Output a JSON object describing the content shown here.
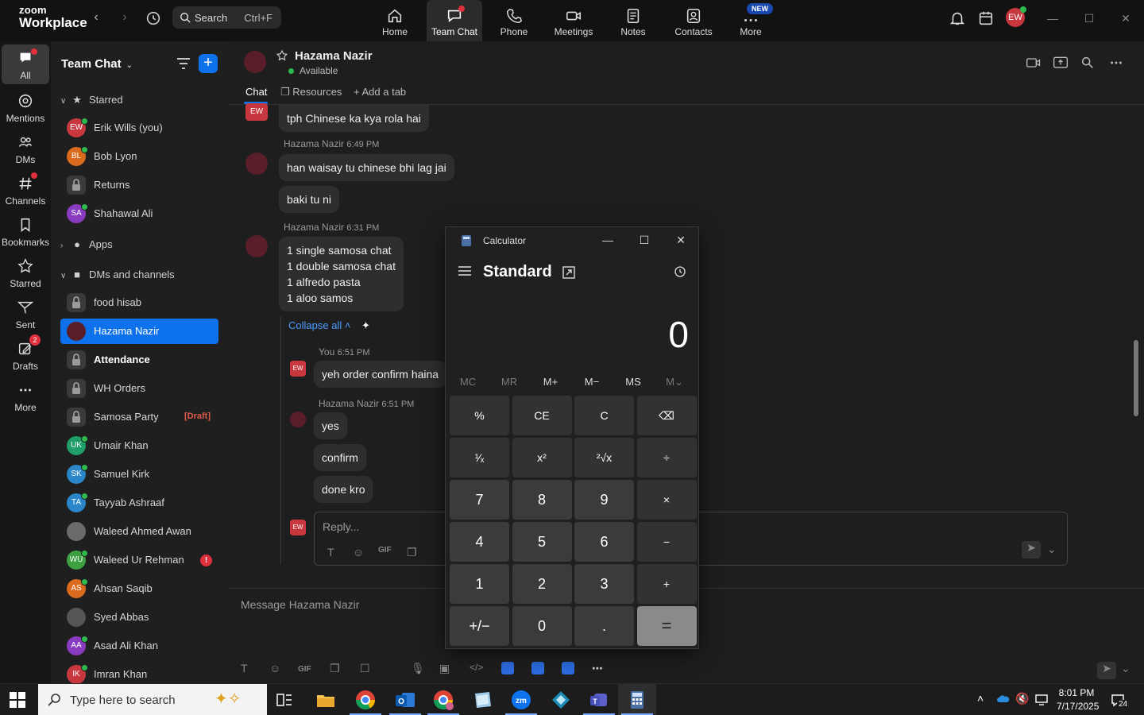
{
  "app": {
    "logo_line1": "zoom",
    "logo_line2": "Workplace",
    "search_label": "Search",
    "search_shortcut": "Ctrl+F",
    "user_initials": "EW",
    "new_badge": "NEW",
    "nav": [
      {
        "label": "Home",
        "icon": "home-icon"
      },
      {
        "label": "Team Chat",
        "icon": "chat-icon"
      },
      {
        "label": "Phone",
        "icon": "phone-icon"
      },
      {
        "label": "Meetings",
        "icon": "video-icon"
      },
      {
        "label": "Notes",
        "icon": "notes-icon"
      },
      {
        "label": "Contacts",
        "icon": "contacts-icon"
      },
      {
        "label": "More",
        "icon": "more-icon"
      }
    ]
  },
  "rail": [
    {
      "label": "All"
    },
    {
      "label": "Mentions"
    },
    {
      "label": "DMs"
    },
    {
      "label": "Channels"
    },
    {
      "label": "Bookmarks"
    },
    {
      "label": "Starred"
    },
    {
      "label": "Sent"
    },
    {
      "label": "Drafts",
      "badge": "2"
    },
    {
      "label": "More"
    }
  ],
  "sidebar": {
    "title": "Team Chat",
    "sections": {
      "starred": "Starred",
      "apps": "Apps",
      "dms": "DMs and channels"
    },
    "starred_items": [
      {
        "name": "Erik Wills (you)",
        "initials": "EW",
        "color": "#c8373e"
      },
      {
        "name": "Bob Lyon",
        "initials": "BL",
        "color": "#d96a1e"
      },
      {
        "name": "Returns",
        "initials": "",
        "color": "#3a3a3a"
      },
      {
        "name": "Shahawal Ali",
        "initials": "SA",
        "color": "#8a3cc0"
      }
    ],
    "dm_items": [
      {
        "name": "food hisab",
        "initials": "",
        "color": "#3a3a3a"
      },
      {
        "name": "Hazama Nazir",
        "initials": "",
        "color": "#5a1e2a"
      },
      {
        "name": "Attendance",
        "initials": "",
        "color": "#3a3a3a"
      },
      {
        "name": "WH Orders",
        "initials": "",
        "color": "#3a3a3a"
      },
      {
        "name": "Samosa Party",
        "initials": "",
        "color": "#3a3a3a",
        "draft": "[Draft]"
      },
      {
        "name": "Umair Khan",
        "initials": "UK",
        "color": "#1f9e6a"
      },
      {
        "name": "Samuel Kirk",
        "initials": "SK",
        "color": "#2a86c8"
      },
      {
        "name": "Tayyab Ashraaf",
        "initials": "TA",
        "color": "#2a86c8"
      },
      {
        "name": "Waleed Ahmed Awan",
        "initials": "",
        "color": "#6b6b6b"
      },
      {
        "name": "Waleed Ur Rehman",
        "initials": "WU",
        "color": "#3ca040",
        "alert": "!"
      },
      {
        "name": "Ahsan Saqib",
        "initials": "AS",
        "color": "#d96a1e"
      },
      {
        "name": "Syed Abbas",
        "initials": "",
        "color": "#555555"
      },
      {
        "name": "Asad Ali Khan",
        "initials": "AA",
        "color": "#8a3cc0"
      },
      {
        "name": "Imran Khan",
        "initials": "IK",
        "color": "#c8373e"
      }
    ]
  },
  "chat": {
    "contact_name": "Hazama Nazir",
    "contact_status": "Available",
    "tabs": [
      "Chat",
      "Resources",
      "Add a tab"
    ],
    "messages": {
      "m1": "tph Chinese ka kya rola hai",
      "m1_avatar": "EW",
      "meta2": "Hazama Nazir",
      "time2": "6:49 PM",
      "m2a": "han waisay tu chinese bhi lag jai",
      "m2b": "baki tu ni",
      "meta3": "Hazama Nazir",
      "time3": "6:31 PM",
      "m3_lines": [
        "1 single samosa chat",
        "1 double samosa chat",
        "1 alfredo pasta",
        "1 aloo samos"
      ],
      "collapse": "Collapse all",
      "meta4": "You",
      "time4": "6:51 PM",
      "m4": "yeh order confirm haina",
      "meta5": "Hazama Nazir",
      "time5": "6:51 PM",
      "m5a": "yes",
      "m5b": "confirm",
      "m5c": "done kro"
    },
    "reply_placeholder": "Reply...",
    "message_placeholder": "Message Hazama Nazir"
  },
  "calculator": {
    "title": "Calculator",
    "mode": "Standard",
    "display": "0",
    "memory": [
      "MC",
      "MR",
      "M+",
      "M−",
      "MS",
      "M⌄"
    ],
    "keys": [
      [
        "%",
        "CE",
        "C",
        "⌫"
      ],
      [
        "¹⁄ₓ",
        "x²",
        "²√x",
        "÷"
      ],
      [
        "7",
        "8",
        "9",
        "×"
      ],
      [
        "4",
        "5",
        "6",
        "−"
      ],
      [
        "1",
        "2",
        "3",
        "+"
      ],
      [
        "+/−",
        "0",
        ".",
        "="
      ]
    ]
  },
  "taskbar": {
    "search_placeholder": "Type here to search",
    "time": "8:01 PM",
    "date": "7/17/2025",
    "notifications": "24"
  }
}
